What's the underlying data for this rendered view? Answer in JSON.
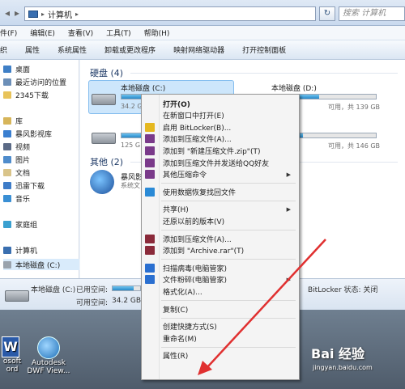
{
  "window": {
    "address_text": "计算机",
    "address_separator": "▸",
    "search_placeholder": "搜索 计算机"
  },
  "menu": [
    "件(F)",
    "编辑(E)",
    "查看(V)",
    "工具(T)",
    "帮助(H)"
  ],
  "toolbar": [
    "织",
    "属性",
    "系统属性",
    "卸载或更改程序",
    "映射网络驱动器",
    "打开控制面板"
  ],
  "sidebar": [
    {
      "label": "桌面",
      "icon": "desktop-icon",
      "color": "#3f7fc6"
    },
    {
      "label": "最近访问的位置",
      "icon": "recent-places-icon",
      "color": "#6c8fb8"
    },
    {
      "label": "2345下载",
      "icon": "folder-icon",
      "color": "#e8c35a"
    },
    {
      "label": "库",
      "icon": "library-icon",
      "color": "#d7b55a"
    },
    {
      "label": "暴风影视库",
      "icon": "video-library-icon",
      "color": "#3a7fd0"
    },
    {
      "label": "视频",
      "icon": "video-icon",
      "color": "#5b6a86"
    },
    {
      "label": "图片",
      "icon": "pictures-icon",
      "color": "#4f8ccc"
    },
    {
      "label": "文档",
      "icon": "documents-icon",
      "color": "#d9c48a"
    },
    {
      "label": "迅雷下载",
      "icon": "thunder-download-icon",
      "color": "#3d7cc8"
    },
    {
      "label": "音乐",
      "icon": "music-icon",
      "color": "#3a8fd4"
    },
    {
      "label": "家庭组",
      "icon": "homegroup-icon",
      "color": "#3aa0d0"
    },
    {
      "label": "计算机",
      "icon": "computer-icon",
      "color": "#3a6fb0"
    },
    {
      "label": "本地磁盘 (C:)",
      "icon": "drive-icon",
      "color": "#9aa3ad"
    }
  ],
  "content": {
    "hdd_group": "硬盘 (4)",
    "other_group": "其他 (2)",
    "drives": [
      {
        "name": "本地磁盘 (C:)",
        "free": "34.2 GB",
        "fill": 0.75
      },
      {
        "name": "本地磁盘 (D:)",
        "info": "可用，共 139 GB",
        "fill": 0.45
      },
      {
        "name": "",
        "free": "125 G",
        "info": "可用，共 146 GB",
        "fill": 0.3
      },
      {
        "name": "",
        "info": "可用，共 139 GB",
        "fill": 0.4
      }
    ],
    "other_items": [
      {
        "name": "暴风影",
        "sub": "系统文"
      }
    ]
  },
  "status": {
    "drive_name": "本地磁盘 (C:)",
    "used_label": "已用空间:",
    "free_label": "可用空间:",
    "free_value": "34.2 GB",
    "bitlocker": "BitLocker 状态: 关闭",
    "used_fill": 0.75
  },
  "context_menu": [
    {
      "label": "打开(O)",
      "bold": true
    },
    {
      "label": "在新窗口中打开(E)"
    },
    {
      "label": "启用 BitLocker(B)...",
      "icon": "bitlocker-shield-icon",
      "color": "#e5b820"
    },
    {
      "label": "添加到压缩文件(A)...",
      "icon": "winrar-icon",
      "color": "#7a3a8a"
    },
    {
      "label": "添加到 \"新建压缩文件.zip\"(T)",
      "icon": "winrar-icon",
      "color": "#7a3a8a"
    },
    {
      "label": "添加到压缩文件并发送给QQ好友",
      "icon": "winrar-icon",
      "color": "#7a3a8a"
    },
    {
      "label": "其他压缩命令",
      "icon": "winrar-icon",
      "color": "#7a3a8a",
      "submenu": true
    },
    {
      "separator": true
    },
    {
      "label": "使用数据恢复找回文件",
      "icon": "data-recovery-icon",
      "color": "#2a8ad6"
    },
    {
      "separator": true
    },
    {
      "label": "共享(H)",
      "submenu": true
    },
    {
      "label": "还原以前的版本(V)"
    },
    {
      "separator": true
    },
    {
      "label": "添加到压缩文件(A)...",
      "icon": "winrar-icon",
      "color": "#8a2a3a"
    },
    {
      "label": "添加到 \"Archive.rar\"(T)",
      "icon": "winrar-icon",
      "color": "#8a2a3a"
    },
    {
      "separator": true
    },
    {
      "label": "扫描病毒(电脑管家)",
      "icon": "pc-manager-icon",
      "color": "#2a6fd0"
    },
    {
      "label": "文件粉碎(电脑管家)",
      "icon": "pc-manager-icon",
      "color": "#2a6fd0",
      "submenu": true
    },
    {
      "label": "格式化(A)..."
    },
    {
      "separator": true
    },
    {
      "label": "复制(C)"
    },
    {
      "separator": true
    },
    {
      "label": "创建快捷方式(S)"
    },
    {
      "label": "重命名(M)"
    },
    {
      "separator": true
    },
    {
      "label": "属性(R)"
    }
  ],
  "desktop_icons": [
    {
      "label1": "osoft",
      "label2": "ord",
      "icon": "word-icon",
      "color": "#2a5aa8"
    },
    {
      "label1": "Autodesk",
      "label2": "DWF View...",
      "icon": "autodesk-dwf-icon",
      "color": "#2a8ad6"
    }
  ],
  "watermark": {
    "text": "Bai 经验",
    "sub": "jingyan.baidu.com"
  },
  "arrow_color": "#e03030"
}
